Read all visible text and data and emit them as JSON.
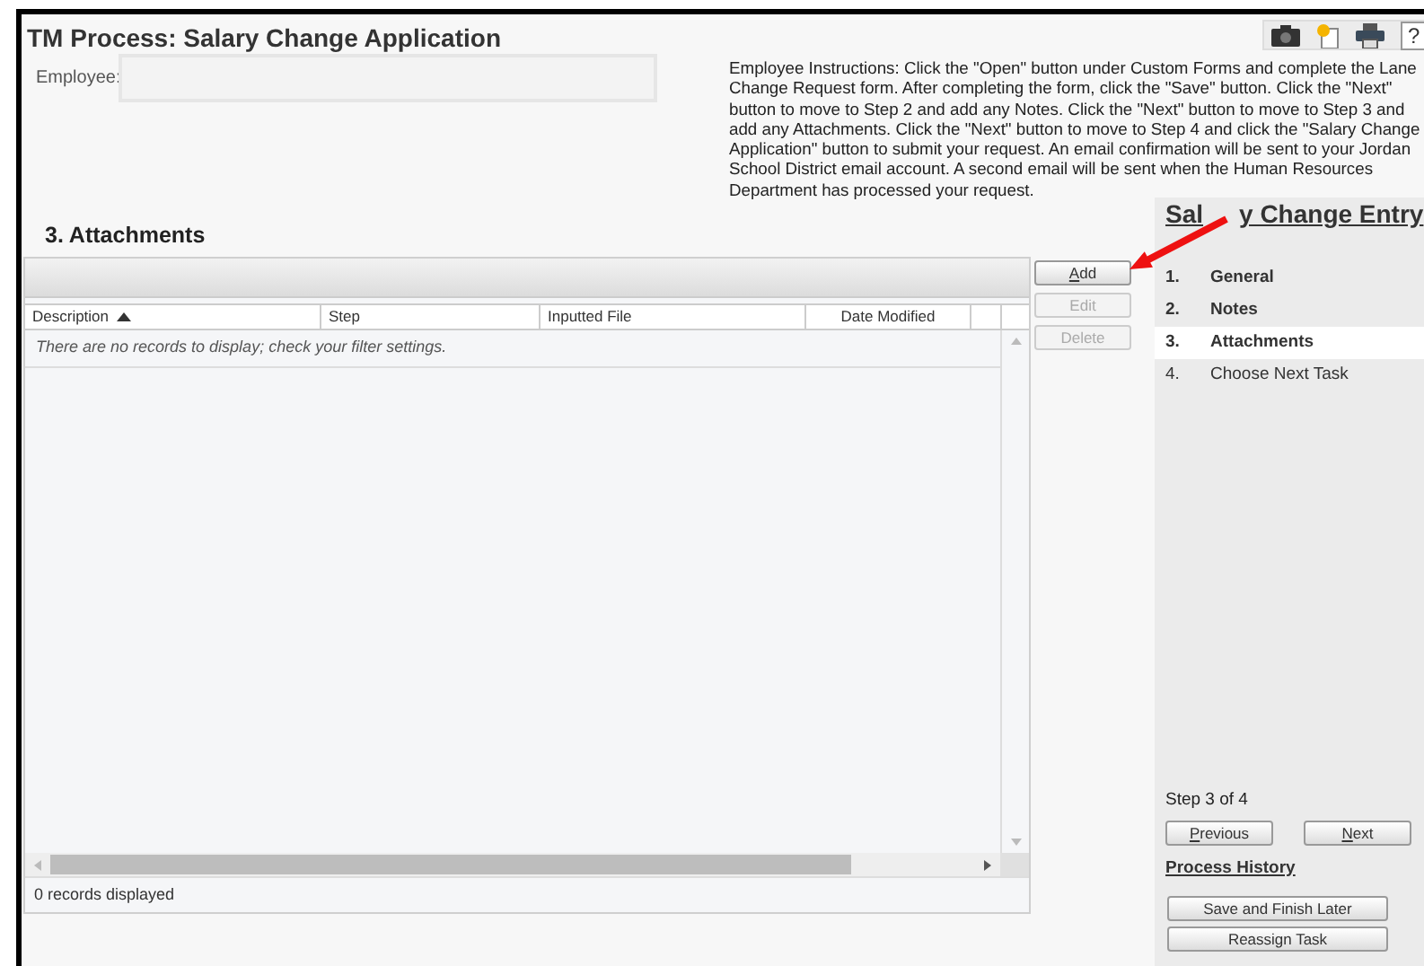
{
  "window": {
    "title": "TM Process: Salary Change Application"
  },
  "employee": {
    "label": "Employee:"
  },
  "toolbar_icons": [
    {
      "kind": "camera"
    },
    {
      "kind": "document"
    },
    {
      "kind": "printer"
    },
    {
      "kind": "help",
      "glyph": "?"
    }
  ],
  "instructions": "Employee Instructions: Click the \"Open\" button under Custom Forms and complete the Lane Change Request form. After completing the form, click the \"Save\" button. Click the \"Next\" button to move to Step 2 and add any Notes. Click the \"Next\" button to move to Step 3 and add any Attachments. Click the \"Next\" button to move to Step 4 and click the \"Salary Change Application\" button to submit your request. An email confirmation will be sent to your Jordan School District email account. A second email will be sent when the Human Resources Department has processed your request.",
  "section_title": "3. Attachments",
  "table": {
    "columns": [
      {
        "label": "Description",
        "sorted": true
      },
      {
        "label": "Step",
        "sorted": false
      },
      {
        "label": "Inputted File",
        "sorted": false
      },
      {
        "label": "Date Modified",
        "sorted": false
      }
    ],
    "empty_message": "There are no records to display; check your filter settings.",
    "footer": "0 records displayed"
  },
  "grid_buttons": [
    {
      "label": "Add",
      "disabled": false
    },
    {
      "label": "Edit",
      "disabled": true
    },
    {
      "label": "Delete",
      "disabled": true
    }
  ],
  "sidebar": {
    "title_parts": [
      "Sal",
      "y Change Entry"
    ],
    "steps": [
      {
        "number": "1.",
        "label": "General",
        "visited": true,
        "selected": false
      },
      {
        "number": "2.",
        "label": "Notes",
        "visited": true,
        "selected": false
      },
      {
        "number": "3.",
        "label": "Attachments",
        "visited": true,
        "selected": true
      },
      {
        "number": "4.",
        "label": "Choose Next Task",
        "visited": false,
        "selected": false
      }
    ],
    "step_counter": "Step 3 of 4",
    "nav_buttons": [
      "Previous",
      "Next"
    ],
    "history_link": "Process History",
    "actions": [
      "Save and Finish Later",
      "Reassign Task"
    ]
  },
  "annotation": {
    "kind": "arrow"
  }
}
